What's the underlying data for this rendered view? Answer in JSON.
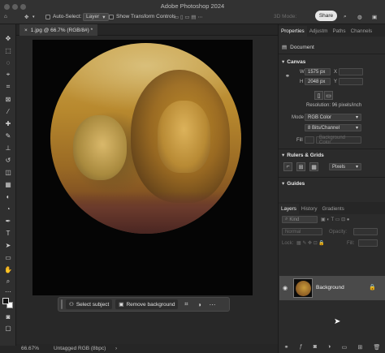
{
  "app": {
    "title": "Adobe Photoshop 2024"
  },
  "options_bar": {
    "auto_select_label": "Auto-Select:",
    "auto_select_target": "Layer",
    "show_transform_label": "Show Transform Controls",
    "mode_3d": "3D Mode:",
    "share_label": "Share"
  },
  "document": {
    "tab_label": "1.jpg @ 66.7% (RGB/8#) *"
  },
  "taskbar": {
    "select_subject": "Select subject",
    "remove_background": "Remove background"
  },
  "status": {
    "zoom": "66.67%",
    "profile": "Untagged RGB (8bpc)"
  },
  "properties": {
    "tabs": [
      "Properties",
      "Adjustm",
      "Paths",
      "Channels"
    ],
    "doc_label": "Document",
    "canvas": {
      "title": "Canvas",
      "w_label": "W",
      "w_value": "1575 px",
      "h_label": "H",
      "h_value": "2048 px",
      "x_label": "X",
      "y_label": "Y",
      "resolution": "Resolution: 96 pixels/inch",
      "mode_label": "Mode",
      "mode_value": "RGB Color",
      "depth_value": "8 Bits/Channel",
      "fill_label": "Fill",
      "fill_value": "Background Color"
    },
    "rulers_title": "Rulers & Grids",
    "units_value": "Pixels",
    "guides_title": "Guides"
  },
  "layers_panel": {
    "tabs": [
      "Layers",
      "History",
      "Gradients"
    ],
    "kind_label": "Kind",
    "blend_mode": "Normal",
    "opacity_label": "Opacity:",
    "lock_label": "Lock:",
    "fill_label": "Fill:",
    "layer_name": "Background"
  }
}
